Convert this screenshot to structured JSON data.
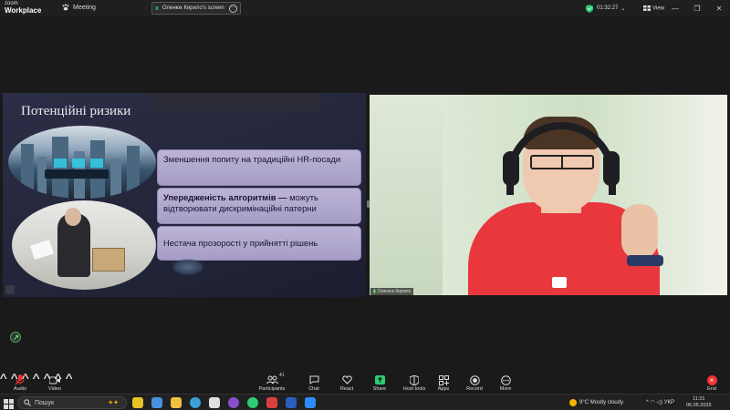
{
  "app": {
    "brand_top": "zoom",
    "brand_bottom": "Workplace",
    "meeting_label": "Meeting",
    "share_label": "Оленюк Кирило's screen",
    "timer": "01:32:27",
    "view_label": "View"
  },
  "slide": {
    "title": "Потенційні ризики",
    "bubble1": "Зменшення попиту на традиційні HR-посади",
    "bubble2_bold": "Упередженість алгоритмів —",
    "bubble2_rest": " можуть відтворювати дискримінаційні патерни",
    "bubble3": "Нестача прозорості у прийнятті рішень"
  },
  "participant": {
    "name": "Оленюк Кирило"
  },
  "toolbar": {
    "audio": "Audio",
    "video": "Video",
    "participants": "Participants",
    "participants_count": "41",
    "chat": "Chat",
    "react": "React",
    "share": "Share",
    "host_tools": "Host tools",
    "apps": "Apps",
    "record": "Record",
    "more": "More",
    "end": "End"
  },
  "taskbar": {
    "search_placeholder": "Пошук",
    "temp": "9°C",
    "weather": "Mostly cloudy",
    "lang": "УКР",
    "time": "11:21",
    "date": "06.05.2025"
  },
  "colors": {
    "accent": "#2ecc71",
    "end_red": "#e33333",
    "bubble": "#b1a9ce",
    "shirt": "#e8383e"
  }
}
